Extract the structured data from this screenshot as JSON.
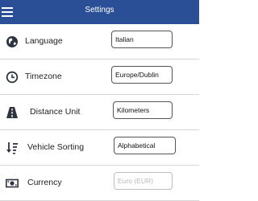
{
  "header": {
    "title": "Settings",
    "menu_icon": "hamburger-menu-icon",
    "color": "#2b4f96"
  },
  "settings": [
    {
      "label": "Language",
      "value": "Italian",
      "icon": "globe-icon"
    },
    {
      "label": "Timezone",
      "value": "Europe/Dublin",
      "icon": "clock-icon"
    },
    {
      "label": "Distance Unit",
      "value": "Kilometers",
      "icon": "road-icon"
    },
    {
      "label": "Vehicle Sorting",
      "value": "Alphabetical",
      "icon": "sort-icon"
    },
    {
      "label": "Currency",
      "value": "",
      "placeholder": "Euro (EUR)",
      "icon": "money-icon"
    }
  ]
}
